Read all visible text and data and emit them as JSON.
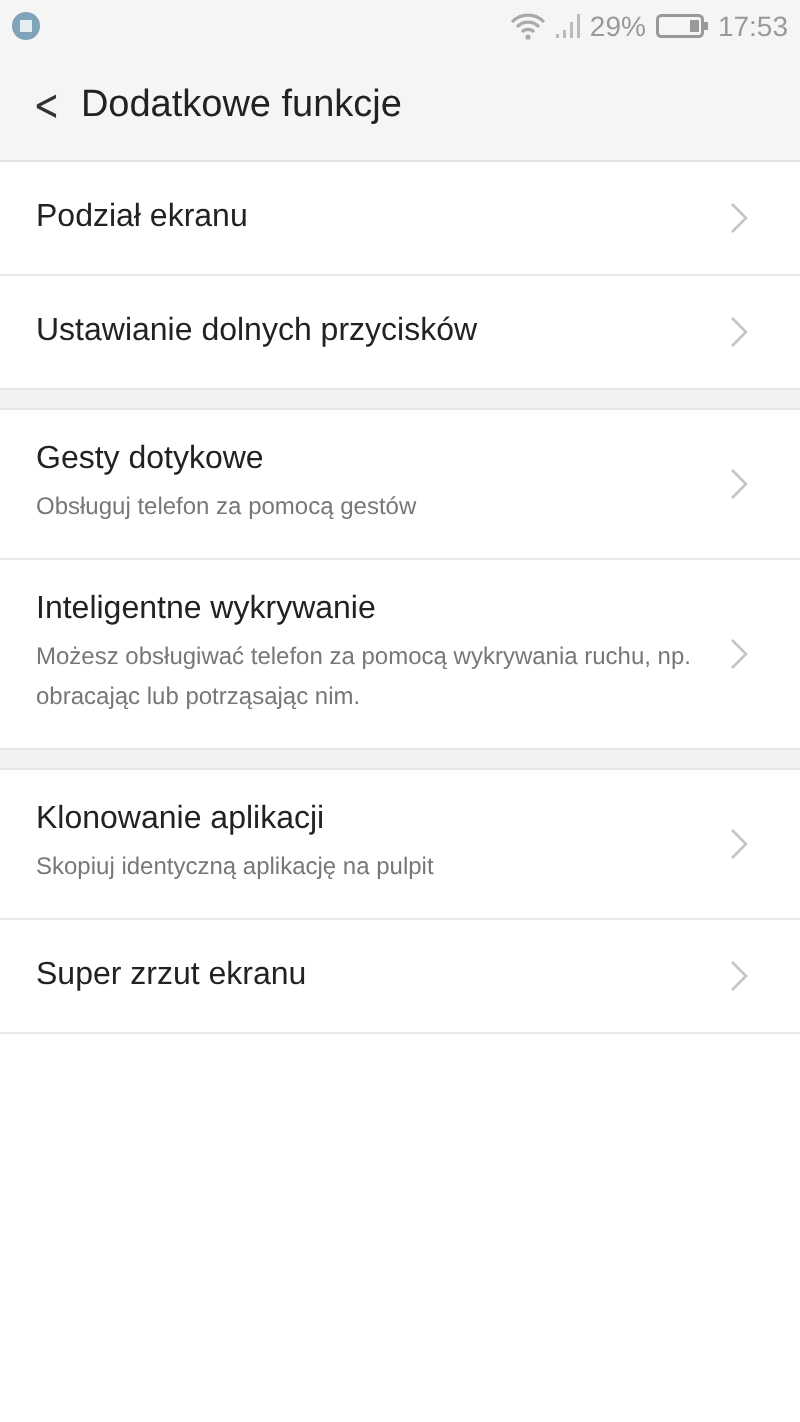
{
  "status_bar": {
    "battery": "29%",
    "time": "17:53"
  },
  "header": {
    "back": "<",
    "title": "Dodatkowe funkcje"
  },
  "sections": [
    {
      "items": [
        {
          "title": "Podział ekranu"
        },
        {
          "title": "Ustawianie dolnych przycisków"
        }
      ]
    },
    {
      "items": [
        {
          "title": "Gesty dotykowe",
          "subtitle": "Obsługuj telefon za pomocą gestów"
        },
        {
          "title": "Inteligentne wykrywanie",
          "subtitle": "Możesz obsługiwać telefon za pomocą wykrywania ruchu, np. obracając lub potrząsając nim."
        }
      ]
    },
    {
      "items": [
        {
          "title": "Klonowanie aplikacji",
          "subtitle": "Skopiuj identyczną aplikację na pulpit"
        },
        {
          "title": "Super zrzut ekranu"
        }
      ]
    }
  ]
}
